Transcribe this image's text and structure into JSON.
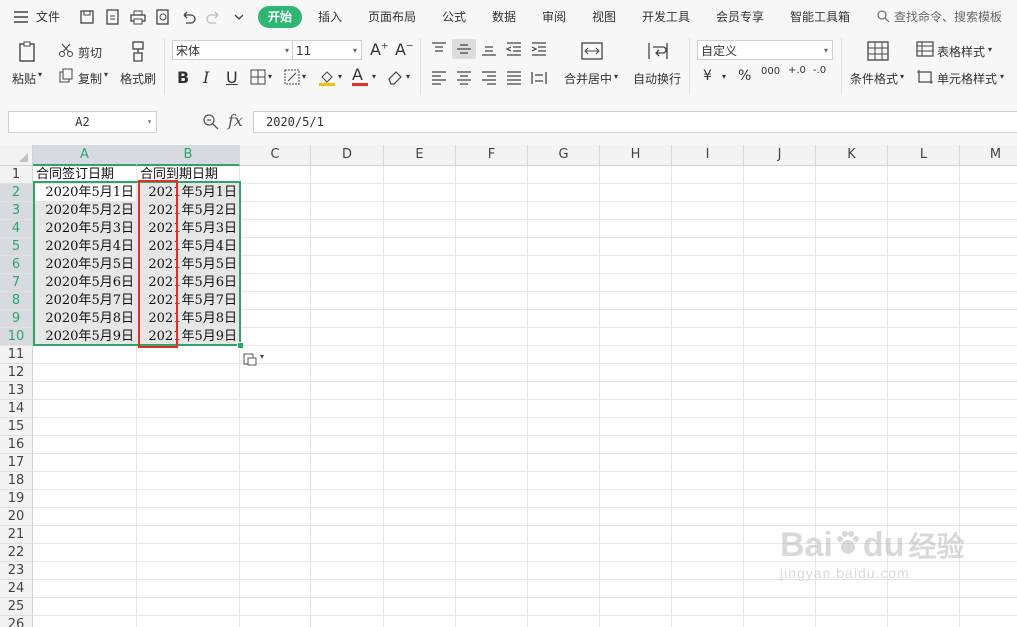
{
  "menu": {
    "file_label": "文件",
    "tabs": [
      "开始",
      "插入",
      "页面布局",
      "公式",
      "数据",
      "审阅",
      "视图",
      "开发工具",
      "会员专享",
      "智能工具箱"
    ],
    "active_tab": "开始",
    "search_placeholder": "查找命令、搜索模板"
  },
  "ribbon": {
    "paste": "粘贴",
    "cut": "剪切",
    "copy": "复制",
    "format_painter": "格式刷",
    "font_name": "宋体",
    "font_size": "11",
    "merge_center": "合并居中",
    "wrap_text": "自动换行",
    "number_format": "自定义",
    "conditional_format": "条件格式",
    "table_style": "表格样式",
    "cell_style": "单元格样式",
    "bold": "B",
    "italic": "I",
    "underline": "U",
    "font_color_letter": "A",
    "currency": "¥",
    "percent": "%",
    "thousands": "000",
    "inc_decimal": "+.0",
    "dec_decimal": "-.0",
    "grow_font": "A+",
    "shrink_font": "A-"
  },
  "formula_bar": {
    "name_box": "A2",
    "fx": "fx",
    "content": "2020/5/1"
  },
  "sheet": {
    "columns": [
      "A",
      "B",
      "C",
      "D",
      "E",
      "F",
      "G",
      "H",
      "I",
      "J",
      "K",
      "L",
      "M"
    ],
    "rows": [
      "1",
      "2",
      "3",
      "4",
      "5",
      "6",
      "7",
      "8",
      "9",
      "10",
      "11",
      "12",
      "13",
      "14",
      "15",
      "16",
      "17",
      "18",
      "19",
      "20",
      "21",
      "22",
      "23",
      "24",
      "25",
      "26"
    ],
    "header_row": [
      "合同签订日期",
      "合同到期日期"
    ],
    "data": [
      [
        "2020年5月1日",
        "2021年5月1日"
      ],
      [
        "2020年5月2日",
        "2021年5月2日"
      ],
      [
        "2020年5月3日",
        "2021年5月3日"
      ],
      [
        "2020年5月4日",
        "2021年5月4日"
      ],
      [
        "2020年5月5日",
        "2021年5月5日"
      ],
      [
        "2020年5月6日",
        "2021年5月6日"
      ],
      [
        "2020年5月7日",
        "2021年5月7日"
      ],
      [
        "2020年5月8日",
        "2021年5月8日"
      ],
      [
        "2020年5月9日",
        "2021年5月9日"
      ]
    ]
  },
  "watermark": {
    "brand": "Bai",
    "brand_suffix": "du",
    "service": "经验",
    "url": "jingyan.baidu.com"
  },
  "colors": {
    "accent_green": "#2fb674",
    "selection_green": "#2fa368",
    "highlight_red": "#e0302a"
  }
}
